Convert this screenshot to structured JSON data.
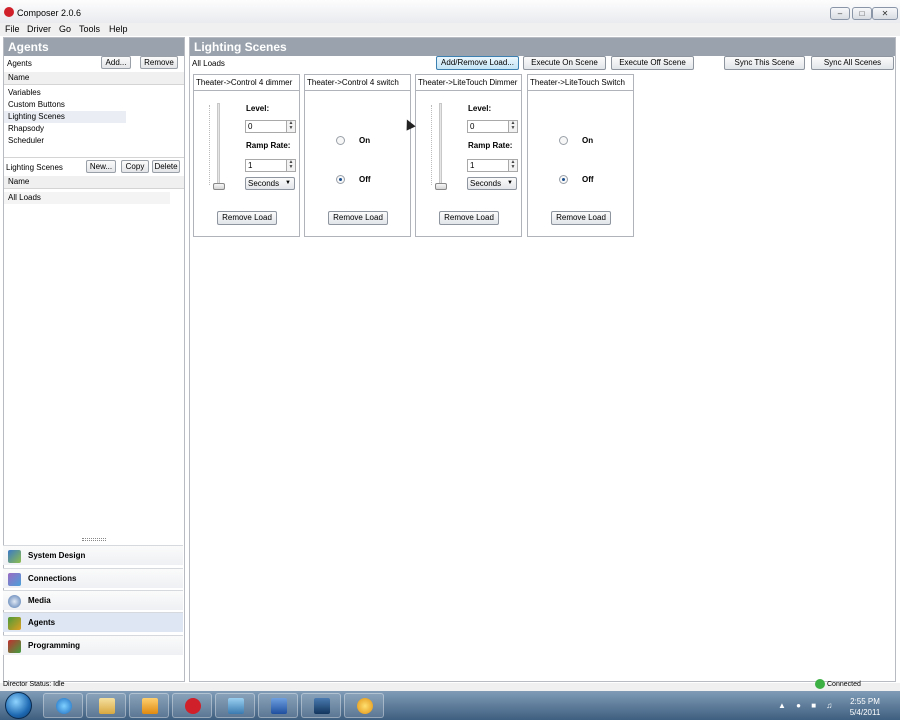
{
  "window": {
    "title": "Composer 2.0.6"
  },
  "menu": [
    "File",
    "Driver",
    "Go",
    "Tools",
    "Help"
  ],
  "agents_panel": {
    "header": "Agents",
    "toolbar_label": "Agents",
    "add_label": "Add...",
    "remove_label": "Remove",
    "column_header": "Name",
    "items": [
      "Variables",
      "Custom Buttons",
      "Lighting Scenes",
      "Rhapsody",
      "Scheduler"
    ],
    "selected_index": 2
  },
  "scenes_panel": {
    "toolbar_label": "Lighting Scenes",
    "new_label": "New...",
    "copy_label": "Copy",
    "delete_label": "Delete",
    "column_header": "Name",
    "items": [
      "All Loads"
    ]
  },
  "nav": [
    {
      "label": "System Design",
      "icon": "system-design-icon"
    },
    {
      "label": "Connections",
      "icon": "connections-icon"
    },
    {
      "label": "Media",
      "icon": "media-icon"
    },
    {
      "label": "Agents",
      "icon": "agents-icon",
      "active": true
    },
    {
      "label": "Programming",
      "icon": "programming-icon"
    }
  ],
  "main": {
    "header": "Lighting Scenes",
    "scene_name": "All Loads",
    "buttons": {
      "add_remove": "Add/Remove Load...",
      "execute_on": "Execute On Scene",
      "execute_off": "Execute Off Scene",
      "sync_this": "Sync This Scene",
      "sync_all": "Sync All Scenes"
    },
    "cards": [
      {
        "title": "Theater->Control 4 dimmer",
        "kind": "dimmer",
        "level_label": "Level:",
        "level_value": "0",
        "ramp_label": "Ramp Rate:",
        "ramp_value": "1",
        "unit": "Seconds",
        "remove_label": "Remove Load"
      },
      {
        "title": "Theater->Control 4 switch",
        "kind": "switch",
        "on_label": "On",
        "off_label": "Off",
        "state": "off",
        "remove_label": "Remove Load"
      },
      {
        "title": "Theater->LiteTouch Dimmer",
        "kind": "dimmer",
        "level_label": "Level:",
        "level_value": "0",
        "ramp_label": "Ramp Rate:",
        "ramp_value": "1",
        "unit": "Seconds",
        "remove_label": "Remove Load"
      },
      {
        "title": "Theater->LiteTouch Switch",
        "kind": "switch",
        "on_label": "On",
        "off_label": "Off",
        "state": "off",
        "remove_label": "Remove Load"
      }
    ]
  },
  "status": {
    "left": "Director Status: Idle",
    "right": "Connected"
  },
  "taskbar": {
    "time": "2:55 PM",
    "date": "5/4/2011"
  },
  "colors": {
    "header_gray": "#9aa3ad",
    "taskbar_blue": "#4a6a8c"
  }
}
